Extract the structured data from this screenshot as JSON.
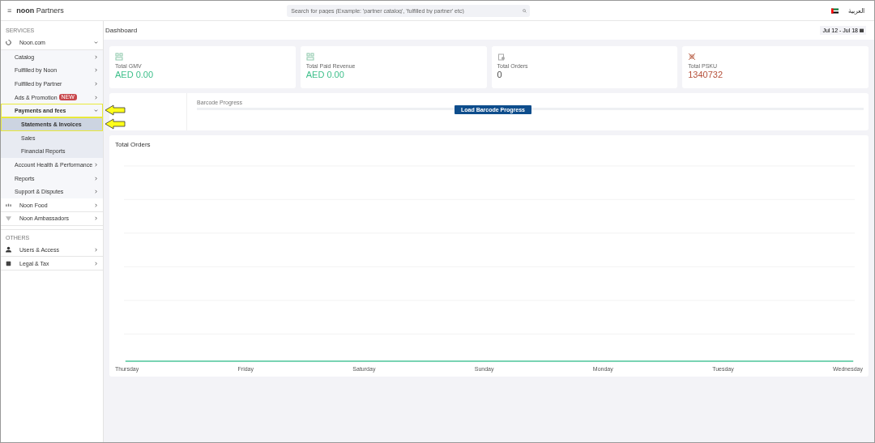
{
  "header": {
    "menu_icon": "≡",
    "brand_bold": "noon",
    "brand_rest": "Partners",
    "search": {
      "placeholder": "Search for pages (Example: 'partner catalog', 'fulfilled by partner' etc)"
    },
    "language": "العربية"
  },
  "sidebar": {
    "sections": [
      {
        "title": "SERVICES",
        "items": [
          {
            "label": "Noon.com",
            "expanded": true,
            "children": [
              {
                "label": "Catalog",
                "expanded": false
              },
              {
                "label": "Fulfilled by Noon",
                "expanded": false
              },
              {
                "label": "Fulfilled by Partner",
                "expanded": false
              },
              {
                "label": "Ads & Promotion",
                "badge": "NEW",
                "expanded": false
              },
              {
                "label": "Payments and fees",
                "expanded": true,
                "highlighted": true,
                "children": [
                  {
                    "label": "Statements & Invoices",
                    "selected": true,
                    "highlighted": true
                  },
                  {
                    "label": "Sales",
                    "selected": false,
                    "highlighted": false
                  },
                  {
                    "label": "Financial Reports",
                    "selected": false,
                    "highlighted": false
                  }
                ]
              },
              {
                "label": "Account Health & Performance",
                "expanded": false
              },
              {
                "label": "Reports",
                "expanded": false
              },
              {
                "label": "Support & Disputes",
                "expanded": false
              }
            ]
          },
          {
            "label": "Noon Food",
            "expanded": false
          },
          {
            "label": "Noon Ambassadors",
            "expanded": false
          }
        ]
      },
      {
        "title": "OTHERS",
        "items": [
          {
            "label": "Users & Access",
            "expanded": false
          },
          {
            "label": "Legal & Tax",
            "expanded": false
          }
        ]
      }
    ]
  },
  "page_title": "Dashboard",
  "date_range": "Jul 12 - Jul 18",
  "stats": [
    {
      "label": "Total GMV",
      "value": "AED 0.00",
      "color": "#3dbf8a"
    },
    {
      "label": "Total Paid Revenue",
      "value": "AED 0.00",
      "color": "#3dbf8a"
    },
    {
      "label": "Total Orders",
      "value": "0",
      "color": "#4d4d4d"
    },
    {
      "label": "Total PSKU",
      "value": "1340732",
      "color": "#b5503a"
    }
  ],
  "barcode": {
    "label": "Barcode Progress",
    "button": "Load Barcode Progress"
  },
  "orders_chart": {
    "title": "Total Orders",
    "x_labels": [
      "Thursday",
      "Friday",
      "Saturday",
      "Sunday",
      "Monday",
      "Tuesday",
      "Wednesday"
    ]
  }
}
